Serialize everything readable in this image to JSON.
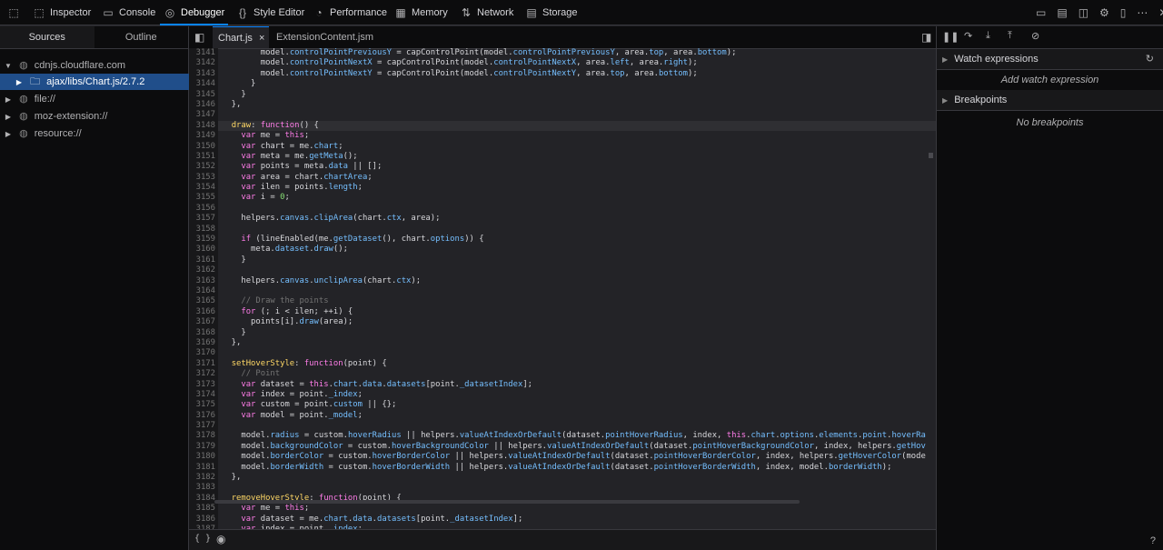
{
  "toolbar": {
    "tabs": [
      {
        "label": "Inspector",
        "icon": "inspector-icon"
      },
      {
        "label": "Console",
        "icon": "console-icon"
      },
      {
        "label": "Debugger",
        "icon": "debugger-icon",
        "active": true
      },
      {
        "label": "Style Editor",
        "icon": "style-editor-icon"
      },
      {
        "label": "Performance",
        "icon": "performance-icon"
      },
      {
        "label": "Memory",
        "icon": "memory-icon"
      },
      {
        "label": "Network",
        "icon": "network-icon"
      },
      {
        "label": "Storage",
        "icon": "storage-icon"
      }
    ]
  },
  "left_panel": {
    "tabs": [
      "Sources",
      "Outline"
    ],
    "tree": [
      {
        "label": "cdnjs.cloudflare.com",
        "expanded": true
      },
      {
        "label": "ajax/libs/Chart.js/2.7.2",
        "selected": true
      },
      {
        "label": "file://"
      },
      {
        "label": "moz-extension://"
      },
      {
        "label": "resource://"
      }
    ]
  },
  "editor": {
    "tabs": [
      {
        "label": "Chart.js",
        "close": "×",
        "active": true
      },
      {
        "label": "ExtensionContent.jsm"
      }
    ],
    "highlight_line": 3148,
    "lines": [
      {
        "n": "3141",
        "t": "        model.controlPointPreviousY = capControlPoint(model.controlPointPreviousY, area.top, area.bottom);"
      },
      {
        "n": "3142",
        "t": "        model.controlPointNextX = capControlPoint(model.controlPointNextX, area.left, area.right);"
      },
      {
        "n": "3143",
        "t": "        model.controlPointNextY = capControlPoint(model.controlPointNextY, area.top, area.bottom);"
      },
      {
        "n": "3144",
        "t": "      }"
      },
      {
        "n": "3145",
        "t": "    }"
      },
      {
        "n": "3146",
        "t": "  },"
      },
      {
        "n": "3147",
        "t": ""
      },
      {
        "n": "3148",
        "t": "  draw: function() {"
      },
      {
        "n": "3149",
        "t": "    var me = this;"
      },
      {
        "n": "3150",
        "t": "    var chart = me.chart;"
      },
      {
        "n": "3151",
        "t": "    var meta = me.getMeta();"
      },
      {
        "n": "3152",
        "t": "    var points = meta.data || [];"
      },
      {
        "n": "3153",
        "t": "    var area = chart.chartArea;"
      },
      {
        "n": "3154",
        "t": "    var ilen = points.length;"
      },
      {
        "n": "3155",
        "t": "    var i = 0;"
      },
      {
        "n": "3156",
        "t": ""
      },
      {
        "n": "3157",
        "t": "    helpers.canvas.clipArea(chart.ctx, area);"
      },
      {
        "n": "3158",
        "t": ""
      },
      {
        "n": "3159",
        "t": "    if (lineEnabled(me.getDataset(), chart.options)) {"
      },
      {
        "n": "3160",
        "t": "      meta.dataset.draw();"
      },
      {
        "n": "3161",
        "t": "    }"
      },
      {
        "n": "3162",
        "t": ""
      },
      {
        "n": "3163",
        "t": "    helpers.canvas.unclipArea(chart.ctx);"
      },
      {
        "n": "3164",
        "t": ""
      },
      {
        "n": "3165",
        "t": "    // Draw the points"
      },
      {
        "n": "3166",
        "t": "    for (; i < ilen; ++i) {"
      },
      {
        "n": "3167",
        "t": "      points[i].draw(area);"
      },
      {
        "n": "3168",
        "t": "    }"
      },
      {
        "n": "3169",
        "t": "  },"
      },
      {
        "n": "3170",
        "t": ""
      },
      {
        "n": "3171",
        "t": "  setHoverStyle: function(point) {"
      },
      {
        "n": "3172",
        "t": "    // Point"
      },
      {
        "n": "3173",
        "t": "    var dataset = this.chart.data.datasets[point._datasetIndex];"
      },
      {
        "n": "3174",
        "t": "    var index = point._index;"
      },
      {
        "n": "3175",
        "t": "    var custom = point.custom || {};"
      },
      {
        "n": "3176",
        "t": "    var model = point._model;"
      },
      {
        "n": "3177",
        "t": ""
      },
      {
        "n": "3178",
        "t": "    model.radius = custom.hoverRadius || helpers.valueAtIndexOrDefault(dataset.pointHoverRadius, index, this.chart.options.elements.point.hoverRa"
      },
      {
        "n": "3179",
        "t": "    model.backgroundColor = custom.hoverBackgroundColor || helpers.valueAtIndexOrDefault(dataset.pointHoverBackgroundColor, index, helpers.getHov"
      },
      {
        "n": "3180",
        "t": "    model.borderColor = custom.hoverBorderColor || helpers.valueAtIndexOrDefault(dataset.pointHoverBorderColor, index, helpers.getHoverColor(mode"
      },
      {
        "n": "3181",
        "t": "    model.borderWidth = custom.hoverBorderWidth || helpers.valueAtIndexOrDefault(dataset.pointHoverBorderWidth, index, model.borderWidth);"
      },
      {
        "n": "3182",
        "t": "  },"
      },
      {
        "n": "3183",
        "t": ""
      },
      {
        "n": "3184",
        "t": "  removeHoverStyle: function(point) {"
      },
      {
        "n": "3185",
        "t": "    var me = this;"
      },
      {
        "n": "3186",
        "t": "    var dataset = me.chart.data.datasets[point._datasetIndex];"
      },
      {
        "n": "3187",
        "t": "    var index = point._index;"
      }
    ]
  },
  "statusbar": {
    "left_icon": "{ }"
  },
  "right_panel": {
    "watch": {
      "title": "Watch expressions",
      "placeholder": "Add watch expression"
    },
    "breakpoints": {
      "title": "Breakpoints",
      "empty": "No breakpoints"
    },
    "help": "?"
  },
  "colors": {
    "keyword": "#ff7de9",
    "function_name": "#ffd866",
    "property": "#75bfff",
    "comment": "#737373",
    "number": "#86de74",
    "accent": "#0a84ff",
    "selection": "#204e8a"
  }
}
